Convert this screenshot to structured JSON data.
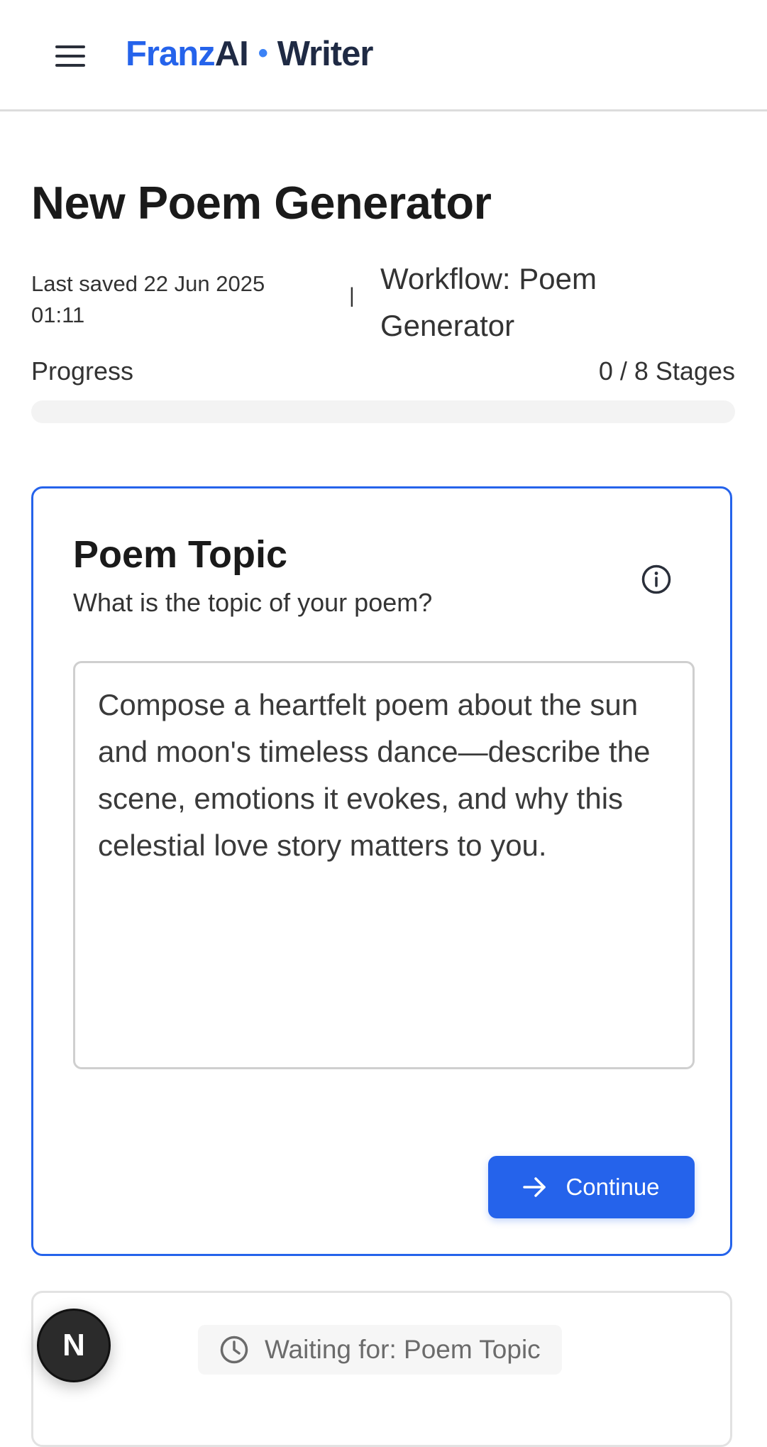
{
  "header": {
    "brand_franz": "Franz",
    "brand_ai": "AI",
    "brand_dot": "•",
    "brand_writer": "Writer"
  },
  "page": {
    "title": "New Poem Generator",
    "last_saved": "Last saved 22 Jun 2025 01:11",
    "separator": "|",
    "workflow": "Workflow: Poem Generator"
  },
  "progress": {
    "label": "Progress",
    "count": "0 / 8 Stages",
    "fraction": 0
  },
  "stage": {
    "title": "Poem Topic",
    "subtitle": "What is the topic of your poem?",
    "input_value": "Compose a heartfelt poem about the sun and moon's timeless dance—describe the scene, emotions it evokes, and why this celestial love story matters to you.",
    "continue_label": "Continue"
  },
  "next_stage": {
    "waiting_label": "Waiting for: Poem Topic"
  },
  "fab": {
    "label": "N"
  },
  "icons": {
    "menu": "menu-icon",
    "info": "info-icon",
    "arrow": "arrow-right-icon",
    "clock": "clock-icon"
  },
  "colors": {
    "accent": "#2563eb",
    "brand_dark": "#1f2a44"
  }
}
